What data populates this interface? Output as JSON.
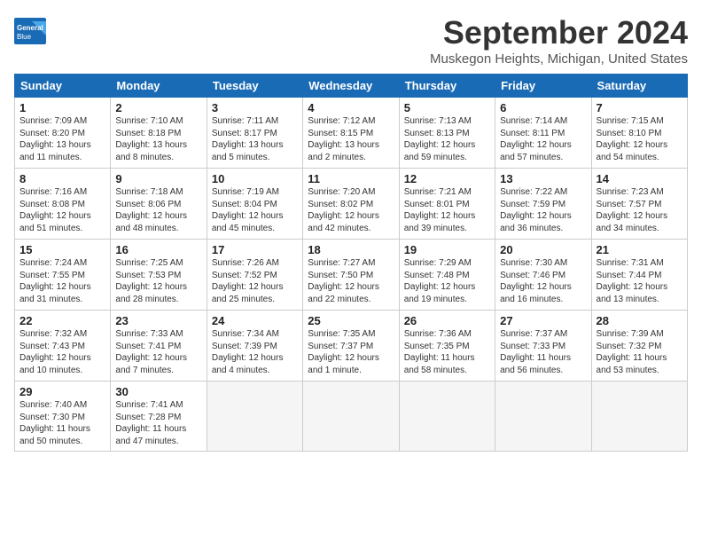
{
  "logo": {
    "line1": "General",
    "line2": "Blue"
  },
  "title": "September 2024",
  "location": "Muskegon Heights, Michigan, United States",
  "headers": [
    "Sunday",
    "Monday",
    "Tuesday",
    "Wednesday",
    "Thursday",
    "Friday",
    "Saturday"
  ],
  "weeks": [
    [
      {
        "day": "1",
        "lines": [
          "Sunrise: 7:09 AM",
          "Sunset: 8:20 PM",
          "Daylight: 13 hours",
          "and 11 minutes."
        ]
      },
      {
        "day": "2",
        "lines": [
          "Sunrise: 7:10 AM",
          "Sunset: 8:18 PM",
          "Daylight: 13 hours",
          "and 8 minutes."
        ]
      },
      {
        "day": "3",
        "lines": [
          "Sunrise: 7:11 AM",
          "Sunset: 8:17 PM",
          "Daylight: 13 hours",
          "and 5 minutes."
        ]
      },
      {
        "day": "4",
        "lines": [
          "Sunrise: 7:12 AM",
          "Sunset: 8:15 PM",
          "Daylight: 13 hours",
          "and 2 minutes."
        ]
      },
      {
        "day": "5",
        "lines": [
          "Sunrise: 7:13 AM",
          "Sunset: 8:13 PM",
          "Daylight: 12 hours",
          "and 59 minutes."
        ]
      },
      {
        "day": "6",
        "lines": [
          "Sunrise: 7:14 AM",
          "Sunset: 8:11 PM",
          "Daylight: 12 hours",
          "and 57 minutes."
        ]
      },
      {
        "day": "7",
        "lines": [
          "Sunrise: 7:15 AM",
          "Sunset: 8:10 PM",
          "Daylight: 12 hours",
          "and 54 minutes."
        ]
      }
    ],
    [
      {
        "day": "8",
        "lines": [
          "Sunrise: 7:16 AM",
          "Sunset: 8:08 PM",
          "Daylight: 12 hours",
          "and 51 minutes."
        ]
      },
      {
        "day": "9",
        "lines": [
          "Sunrise: 7:18 AM",
          "Sunset: 8:06 PM",
          "Daylight: 12 hours",
          "and 48 minutes."
        ]
      },
      {
        "day": "10",
        "lines": [
          "Sunrise: 7:19 AM",
          "Sunset: 8:04 PM",
          "Daylight: 12 hours",
          "and 45 minutes."
        ]
      },
      {
        "day": "11",
        "lines": [
          "Sunrise: 7:20 AM",
          "Sunset: 8:02 PM",
          "Daylight: 12 hours",
          "and 42 minutes."
        ]
      },
      {
        "day": "12",
        "lines": [
          "Sunrise: 7:21 AM",
          "Sunset: 8:01 PM",
          "Daylight: 12 hours",
          "and 39 minutes."
        ]
      },
      {
        "day": "13",
        "lines": [
          "Sunrise: 7:22 AM",
          "Sunset: 7:59 PM",
          "Daylight: 12 hours",
          "and 36 minutes."
        ]
      },
      {
        "day": "14",
        "lines": [
          "Sunrise: 7:23 AM",
          "Sunset: 7:57 PM",
          "Daylight: 12 hours",
          "and 34 minutes."
        ]
      }
    ],
    [
      {
        "day": "15",
        "lines": [
          "Sunrise: 7:24 AM",
          "Sunset: 7:55 PM",
          "Daylight: 12 hours",
          "and 31 minutes."
        ]
      },
      {
        "day": "16",
        "lines": [
          "Sunrise: 7:25 AM",
          "Sunset: 7:53 PM",
          "Daylight: 12 hours",
          "and 28 minutes."
        ]
      },
      {
        "day": "17",
        "lines": [
          "Sunrise: 7:26 AM",
          "Sunset: 7:52 PM",
          "Daylight: 12 hours",
          "and 25 minutes."
        ]
      },
      {
        "day": "18",
        "lines": [
          "Sunrise: 7:27 AM",
          "Sunset: 7:50 PM",
          "Daylight: 12 hours",
          "and 22 minutes."
        ]
      },
      {
        "day": "19",
        "lines": [
          "Sunrise: 7:29 AM",
          "Sunset: 7:48 PM",
          "Daylight: 12 hours",
          "and 19 minutes."
        ]
      },
      {
        "day": "20",
        "lines": [
          "Sunrise: 7:30 AM",
          "Sunset: 7:46 PM",
          "Daylight: 12 hours",
          "and 16 minutes."
        ]
      },
      {
        "day": "21",
        "lines": [
          "Sunrise: 7:31 AM",
          "Sunset: 7:44 PM",
          "Daylight: 12 hours",
          "and 13 minutes."
        ]
      }
    ],
    [
      {
        "day": "22",
        "lines": [
          "Sunrise: 7:32 AM",
          "Sunset: 7:43 PM",
          "Daylight: 12 hours",
          "and 10 minutes."
        ]
      },
      {
        "day": "23",
        "lines": [
          "Sunrise: 7:33 AM",
          "Sunset: 7:41 PM",
          "Daylight: 12 hours",
          "and 7 minutes."
        ]
      },
      {
        "day": "24",
        "lines": [
          "Sunrise: 7:34 AM",
          "Sunset: 7:39 PM",
          "Daylight: 12 hours",
          "and 4 minutes."
        ]
      },
      {
        "day": "25",
        "lines": [
          "Sunrise: 7:35 AM",
          "Sunset: 7:37 PM",
          "Daylight: 12 hours",
          "and 1 minute."
        ]
      },
      {
        "day": "26",
        "lines": [
          "Sunrise: 7:36 AM",
          "Sunset: 7:35 PM",
          "Daylight: 11 hours",
          "and 58 minutes."
        ]
      },
      {
        "day": "27",
        "lines": [
          "Sunrise: 7:37 AM",
          "Sunset: 7:33 PM",
          "Daylight: 11 hours",
          "and 56 minutes."
        ]
      },
      {
        "day": "28",
        "lines": [
          "Sunrise: 7:39 AM",
          "Sunset: 7:32 PM",
          "Daylight: 11 hours",
          "and 53 minutes."
        ]
      }
    ],
    [
      {
        "day": "29",
        "lines": [
          "Sunrise: 7:40 AM",
          "Sunset: 7:30 PM",
          "Daylight: 11 hours",
          "and 50 minutes."
        ]
      },
      {
        "day": "30",
        "lines": [
          "Sunrise: 7:41 AM",
          "Sunset: 7:28 PM",
          "Daylight: 11 hours",
          "and 47 minutes."
        ]
      },
      null,
      null,
      null,
      null,
      null
    ]
  ]
}
